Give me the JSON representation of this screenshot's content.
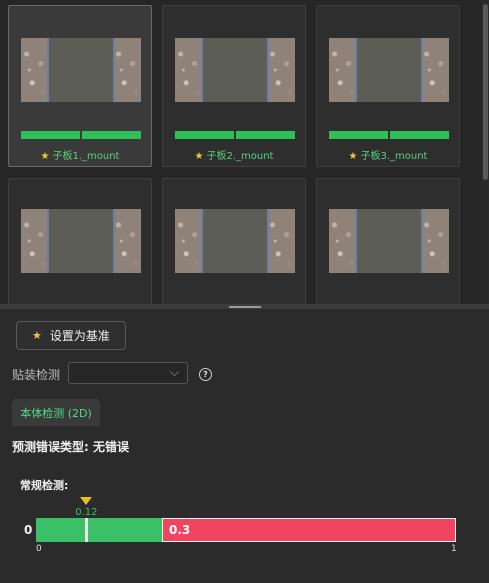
{
  "gallery": {
    "items": [
      {
        "caption": "子板1._mount",
        "selected": true,
        "bars": 2
      },
      {
        "caption": "子板2._mount",
        "selected": false,
        "bars": 2
      },
      {
        "caption": "子板3._mount",
        "selected": false,
        "bars": 2
      },
      {
        "caption": "",
        "selected": false,
        "bars": 0
      },
      {
        "caption": "",
        "selected": false,
        "bars": 0
      },
      {
        "caption": "",
        "selected": false,
        "bars": 0
      }
    ],
    "star_icon": "star-icon",
    "bar_color": "#2dbf58"
  },
  "controls": {
    "set_base_label": "设置为基准",
    "mount_label": "贴装检测",
    "mount_select_value": "",
    "help_symbol": "?",
    "tab_label": "本体检测 (2D)"
  },
  "prediction": {
    "text": "预测错误类型: 无错误"
  },
  "regular": {
    "title": "常规检测:",
    "left_value": "0",
    "threshold": 0.3,
    "threshold_label": "0.3",
    "marker": 0.12,
    "marker_label": "0.12",
    "axis_min": "0",
    "axis_max": "1",
    "colors": {
      "pass": "#3bbf67",
      "fail": "#f04560",
      "marker": "#e7c026"
    }
  }
}
